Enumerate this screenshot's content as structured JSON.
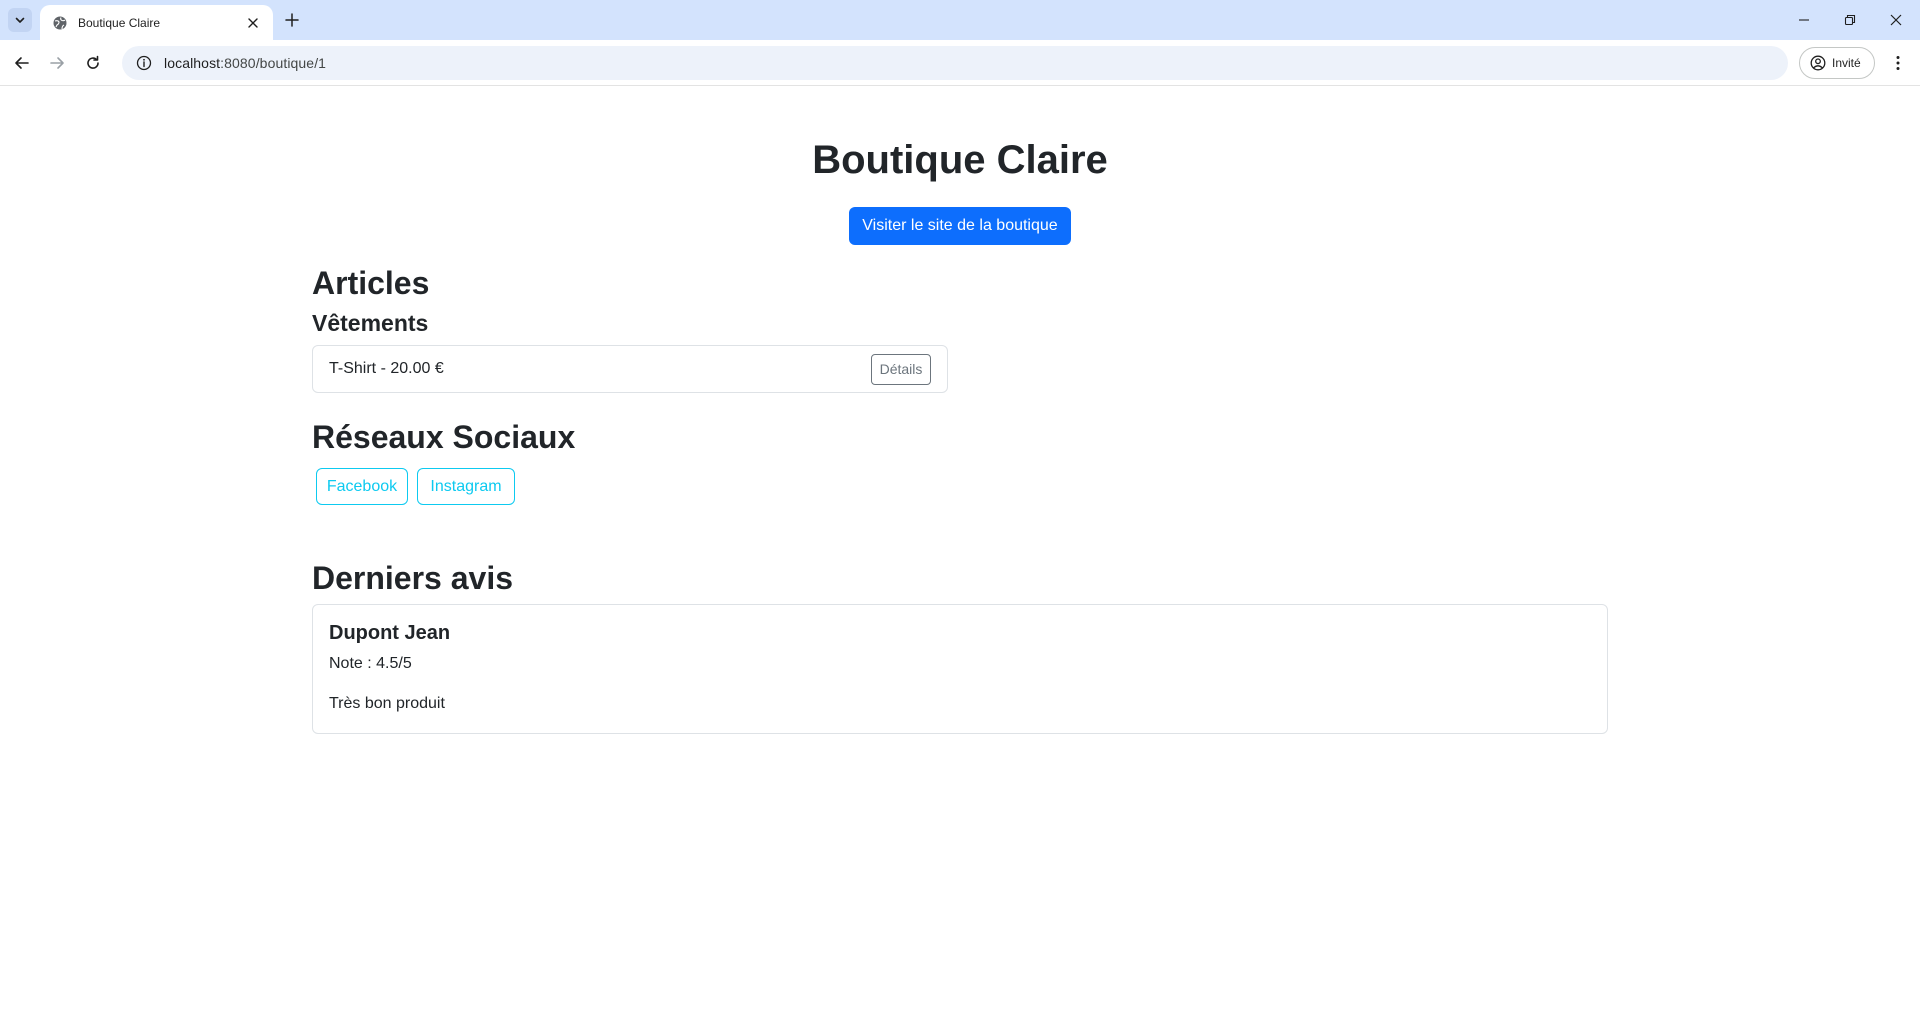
{
  "browser": {
    "tab_title": "Boutique Claire",
    "url_host": "localhost",
    "url_path": ":8080/boutique/1",
    "profile_label": "Invité"
  },
  "page": {
    "shop_name": "Boutique Claire",
    "visit_button": "Visiter le site de la boutique",
    "articles_heading": "Articles",
    "categories": [
      {
        "name": "Vêtements",
        "items": [
          {
            "label": "T-Shirt - 20.00 €",
            "details_button": "Détails"
          }
        ]
      }
    ],
    "social_heading": "Réseaux Sociaux",
    "social_links": [
      "Facebook",
      "Instagram"
    ],
    "reviews_heading": "Derniers avis",
    "reviews": [
      {
        "author": "Dupont Jean",
        "note": "Note : 4.5/5",
        "text": "Très bon produit"
      }
    ]
  },
  "colors": {
    "primary": "#0d6efd",
    "info": "#0dcaf0",
    "secondary": "#6c757d",
    "tabstrip": "#d3e3fd",
    "omnibox": "#edf2fa"
  }
}
